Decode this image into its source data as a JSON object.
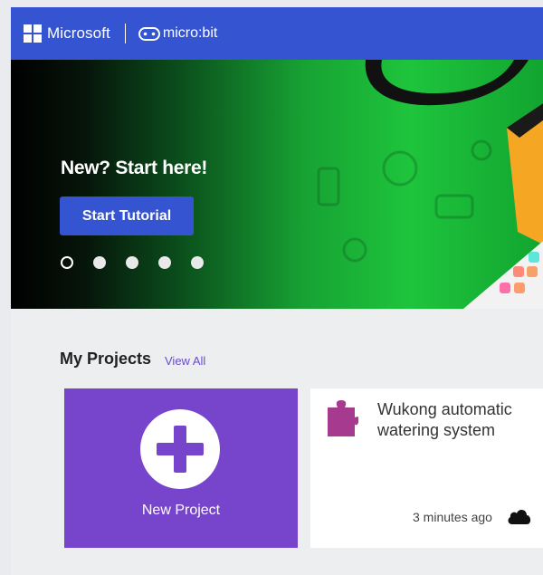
{
  "header": {
    "brand": "Microsoft",
    "product": "micro:bit"
  },
  "hero": {
    "title": "New? Start here!",
    "button": "Start Tutorial",
    "slides": 5,
    "active_slide": 1
  },
  "projects": {
    "title": "My Projects",
    "view_all": "View All",
    "new_project_label": "New Project",
    "items": [
      {
        "name": "Wukong automatic watering system",
        "time": "3 minutes ago",
        "icon": "puzzle-icon",
        "status_icon": "cloud-icon"
      }
    ]
  },
  "colors": {
    "header_blue": "#3454d1",
    "new_card_purple": "#7744cc",
    "puzzle_magenta": "#a63a8e"
  }
}
